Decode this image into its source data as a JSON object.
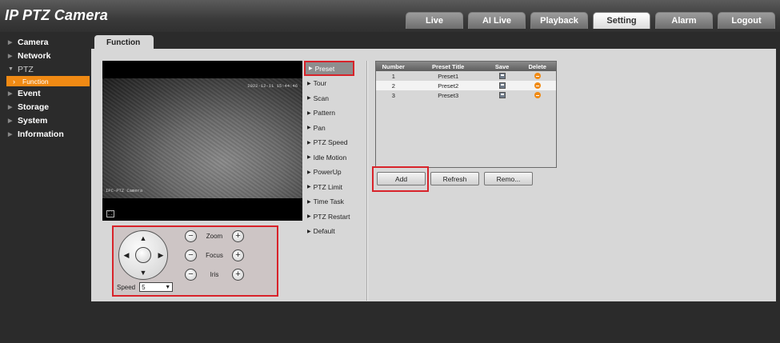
{
  "app": {
    "title": "IP PTZ Camera"
  },
  "nav": {
    "tabs": [
      {
        "label": "Live"
      },
      {
        "label": "AI Live"
      },
      {
        "label": "Playback"
      },
      {
        "label": "Setting"
      },
      {
        "label": "Alarm"
      },
      {
        "label": "Logout"
      }
    ],
    "active": "Setting"
  },
  "sidebar": {
    "items": [
      {
        "label": "Camera"
      },
      {
        "label": "Network"
      },
      {
        "label": "PTZ"
      },
      {
        "label": "Event"
      },
      {
        "label": "Storage"
      },
      {
        "label": "System"
      },
      {
        "label": "Information"
      }
    ],
    "sub_active": "Function"
  },
  "content": {
    "tab": "Function"
  },
  "video": {
    "timestamp": "2022-12-11 15:44:46",
    "osd": "IPC-PTZ Camera"
  },
  "ptz": {
    "zoom_label": "Zoom",
    "focus_label": "Focus",
    "iris_label": "Iris",
    "speed_label": "Speed",
    "speed_value": "5",
    "minus": "−",
    "plus": "+"
  },
  "menu": {
    "items": [
      {
        "label": "Preset"
      },
      {
        "label": "Tour"
      },
      {
        "label": "Scan"
      },
      {
        "label": "Pattern"
      },
      {
        "label": "Pan"
      },
      {
        "label": "PTZ Speed"
      },
      {
        "label": "Idle Motion"
      },
      {
        "label": "PowerUp"
      },
      {
        "label": "PTZ Limit"
      },
      {
        "label": "Time Task"
      },
      {
        "label": "PTZ Restart"
      },
      {
        "label": "Default"
      }
    ],
    "active": "Preset"
  },
  "preset_table": {
    "headers": [
      "Number",
      "Preset Title",
      "Save",
      "Delete"
    ],
    "rows": [
      {
        "number": "1",
        "title": "Preset1"
      },
      {
        "number": "2",
        "title": "Preset2"
      },
      {
        "number": "3",
        "title": "Preset3"
      }
    ]
  },
  "buttons": {
    "add": "Add",
    "refresh": "Refresh",
    "remove": "Remo..."
  },
  "colors": {
    "accent": "#f08a14",
    "highlight": "#d8232a"
  }
}
